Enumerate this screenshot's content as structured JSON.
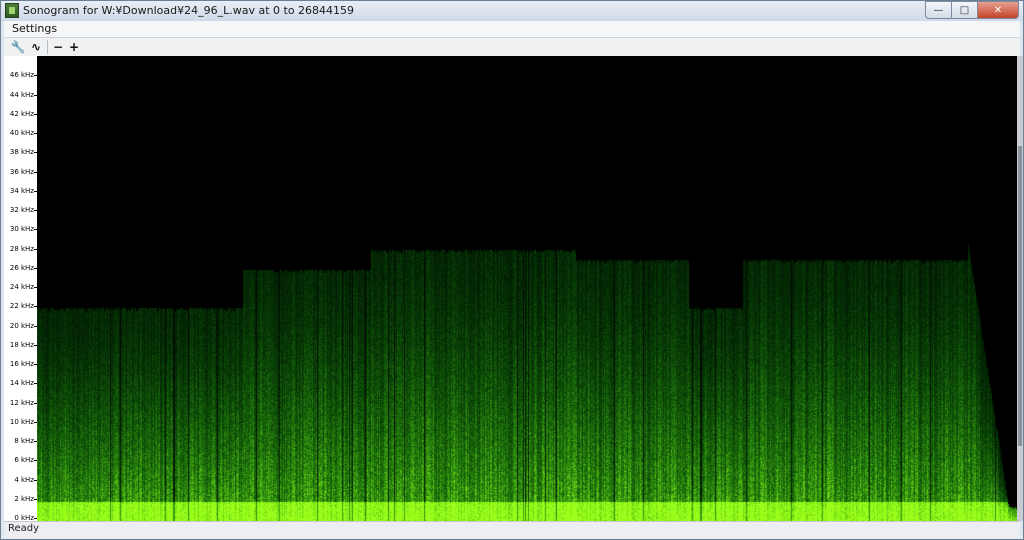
{
  "window": {
    "title": "Sonogram for W:¥Download¥24_96_L.wav at 0 to 26844159",
    "minimize_glyph": "—",
    "maximize_glyph": "□",
    "close_glyph": "✕"
  },
  "menu": {
    "settings_label": "Settings"
  },
  "toolbar": {
    "buttons": [
      {
        "icon": "wrench-icon",
        "glyph": "🔧"
      },
      {
        "icon": "waveform-icon",
        "glyph": "∿"
      },
      {
        "icon": "minus-icon",
        "glyph": "−"
      },
      {
        "icon": "plus-icon",
        "glyph": "+"
      }
    ]
  },
  "axis": {
    "labels": [
      "46 kHz",
      "44 kHz",
      "42 kHz",
      "40 kHz",
      "38 kHz",
      "36 kHz",
      "34 kHz",
      "32 kHz",
      "30 kHz",
      "28 kHz",
      "26 kHz",
      "24 kHz",
      "22 kHz",
      "20 kHz",
      "18 kHz",
      "16 kHz",
      "14 kHz",
      "12 kHz",
      "10 kHz",
      "8 kHz",
      "6 kHz",
      "4 kHz",
      "2 kHz",
      "0 kHz"
    ],
    "max_khz": 48
  },
  "spectrogram": {
    "color": "#9bff1a",
    "segments": [
      {
        "start": 0.0,
        "end": 0.21,
        "cutoff_khz": 22
      },
      {
        "start": 0.21,
        "end": 0.34,
        "cutoff_khz": 26
      },
      {
        "start": 0.34,
        "end": 0.55,
        "cutoff_khz": 28
      },
      {
        "start": 0.55,
        "end": 0.665,
        "cutoff_khz": 27
      },
      {
        "start": 0.665,
        "end": 0.72,
        "cutoff_khz": 22
      },
      {
        "start": 0.72,
        "end": 0.95,
        "cutoff_khz": 27
      }
    ]
  },
  "status": {
    "text": "Ready"
  }
}
